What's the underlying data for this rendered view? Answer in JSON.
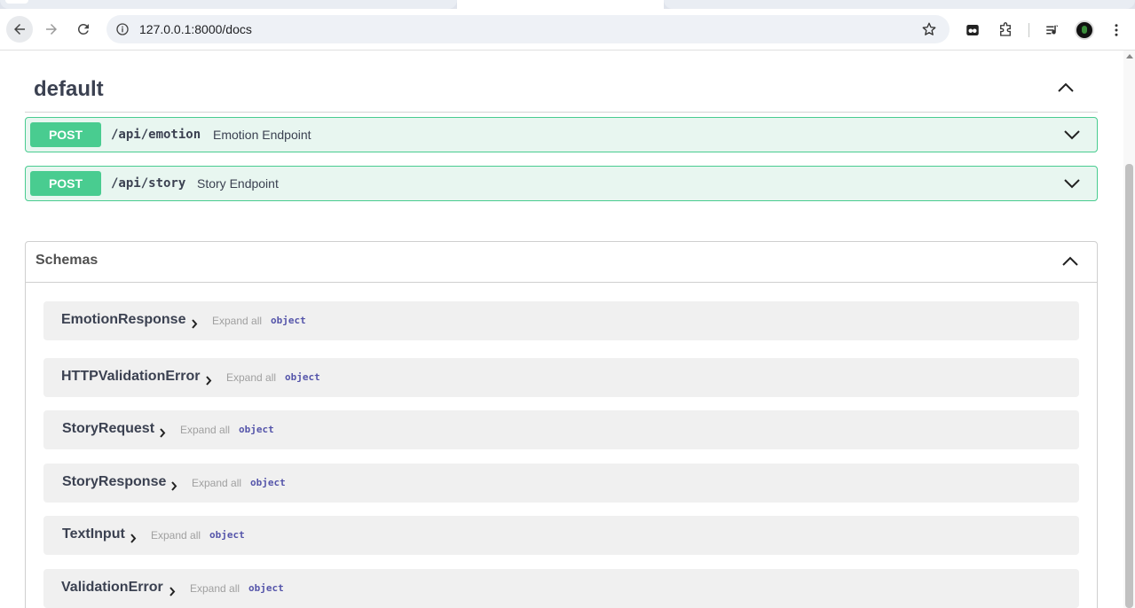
{
  "browser": {
    "url": "127.0.0.1:8000/docs"
  },
  "section": {
    "title": "default"
  },
  "operations": [
    {
      "method": "POST",
      "path": "/api/emotion",
      "summary": "Emotion Endpoint"
    },
    {
      "method": "POST",
      "path": "/api/story",
      "summary": "Story Endpoint"
    }
  ],
  "schemas": {
    "title": "Schemas",
    "items": [
      {
        "name": "EmotionResponse",
        "expand": "Expand all",
        "type": "object"
      },
      {
        "name": "HTTPValidationError",
        "expand": "Expand all",
        "type": "object"
      },
      {
        "name": "StoryRequest",
        "expand": "Expand all",
        "type": "object"
      },
      {
        "name": "StoryResponse",
        "expand": "Expand all",
        "type": "object"
      },
      {
        "name": "TextInput",
        "expand": "Expand all",
        "type": "object"
      },
      {
        "name": "ValidationError",
        "expand": "Expand all",
        "type": "object"
      }
    ]
  },
  "colors": {
    "post": "#49cc90",
    "post_bg": "#e8f6f0"
  },
  "icons": [
    "back-icon",
    "forward-icon",
    "reload-icon",
    "site-info-icon",
    "star-icon",
    "extension-icon",
    "puzzle-icon",
    "media-icon",
    "avatar",
    "menu-icon",
    "chevron-up-icon",
    "chevron-down-icon",
    "chevron-right-icon"
  ]
}
